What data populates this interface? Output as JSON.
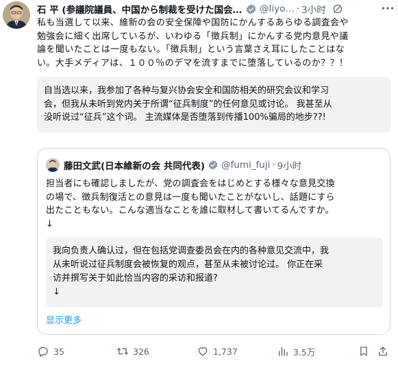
{
  "post": {
    "author_name": "石 平 (参議院議員、中国から制裁を受けた国会…",
    "author_handle": "@liyo…",
    "separator": "·",
    "time": "3小时",
    "text_lines": [
      "私も当選して以来、維新の会の安全保障や国防にかんするあらゆる調査会や",
      "勉強会に細く出席しているが、いわゆる「徴兵制」にかんする党内意見や議",
      "論を聞いたことは一度もない。「徴兵制」という言葉さえ耳にしたことはな",
      "い。大手メディアは、１００％のデマを流すまでに堕落しているのか？？！"
    ],
    "translation_lines": [
      "自当选以来，我参加了各种与复兴协会安全和国防相关的研究会议和学习",
      "会，但我从未听到党内关于所谓“征兵制度”的任何意见或讨论。 我甚至从",
      "没听说过“征兵”这个词。 主流媒体是否堕落到传播100%骗局的地步??!"
    ]
  },
  "quoted": {
    "author_name": "藤田文武(日本維新の会 共同代表)",
    "author_handle": "@fumi_fuji",
    "separator": "·",
    "time": "9小时",
    "text_lines": [
      "担当者にも確認しましたが、党の調査会をはじめとする様々な意見交換",
      "の場で、徴兵制復活との意見は一度も聞いたことがないし、話題にすら",
      "出たこともない。こんな適当なことを誰に取材して書いてるんですか。",
      "↓"
    ],
    "translation_lines": [
      "我向负责人确认过，但在包括党调查委员会在内的各种意见交流中，我",
      "从未听说过征兵制度会被恢复的观点，甚至从未被讨论过。 你正在采",
      "访并撰写关于如此恰当内容的采访和报道?",
      "↓"
    ],
    "show_more": "显示更多"
  },
  "actions": {
    "reply_count": "35",
    "retweet_count": "326",
    "like_count": "1,737",
    "view_count": "3.5万"
  },
  "icons": {
    "verified_badge": "verified-badge-icon",
    "edited": "edit-icon",
    "more": "more-icon",
    "reply": "reply-icon",
    "retweet": "retweet-icon",
    "like": "heart-icon",
    "views": "views-icon",
    "bookmark": "bookmark-icon",
    "share": "share-icon"
  },
  "colors": {
    "text": "#0f1419",
    "secondary": "#536471",
    "link": "#1d9bf0",
    "translation_bg": "#f3f1f2",
    "border": "#cfd9de"
  }
}
